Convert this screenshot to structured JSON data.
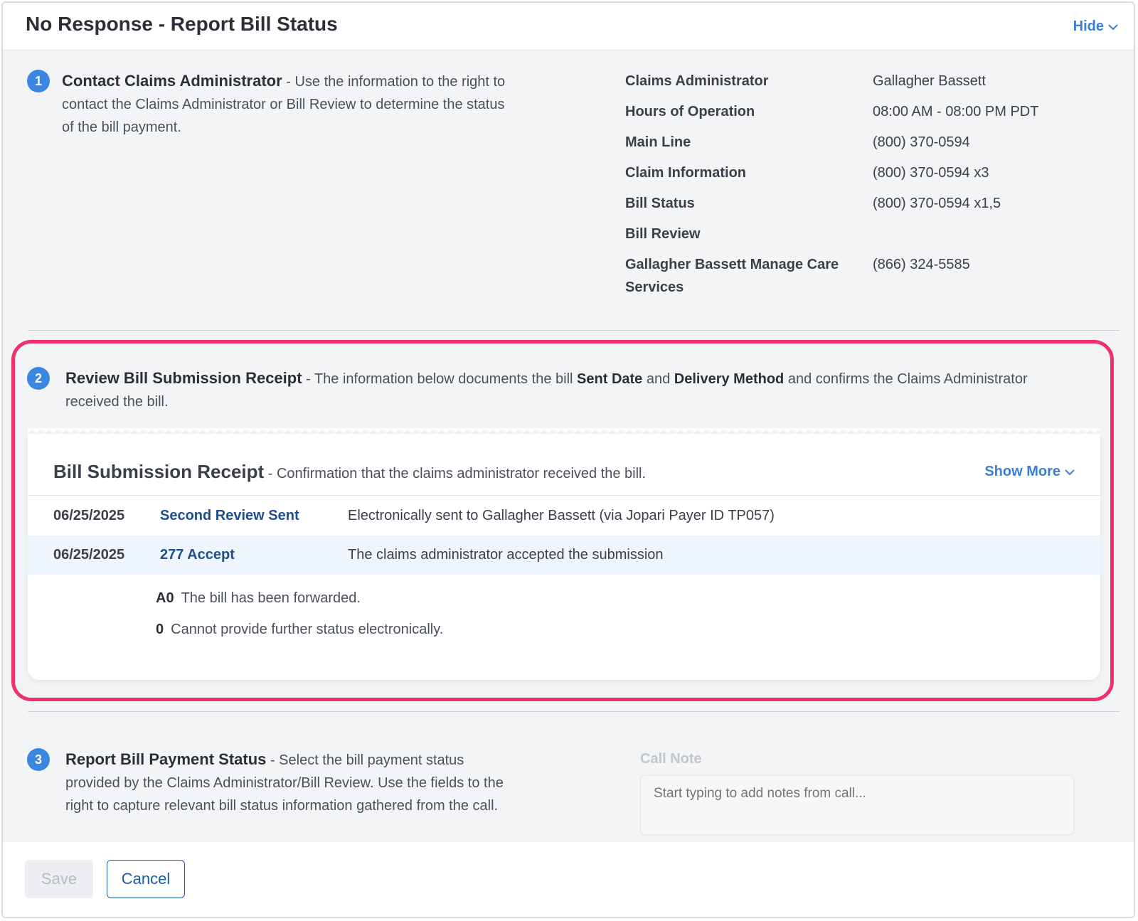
{
  "header": {
    "title": "No Response - Report Bill Status",
    "hide_label": "Hide"
  },
  "step1": {
    "number": "1",
    "heading": "Contact Claims Administrator",
    "text": " - Use the information to the right to contact the Claims Administrator or Bill Review to determine the status of the bill payment."
  },
  "contact_info": [
    {
      "label": "Claims Administrator",
      "value": "Gallagher Bassett"
    },
    {
      "label": "Hours of Operation",
      "value": "08:00 AM - 08:00 PM PDT"
    },
    {
      "label": "Main Line",
      "value": "(800) 370-0594"
    },
    {
      "label": "Claim Information",
      "value": "(800) 370-0594 x3"
    },
    {
      "label": "Bill Status",
      "value": "(800) 370-0594 x1,5"
    },
    {
      "label": "Bill Review",
      "value": ""
    },
    {
      "label": "Gallagher Bassett Manage Care Services",
      "value": "(866) 324-5585"
    }
  ],
  "step2": {
    "number": "2",
    "heading": "Review Bill Submission Receipt",
    "text_a": " - The information below documents the bill ",
    "bold_a": "Sent Date",
    "text_b": " and ",
    "bold_b": "Delivery Method",
    "text_c": " and confirms the Claims Administrator received the bill."
  },
  "receipt": {
    "title": "Bill Submission Receipt",
    "subtitle": " - Confirmation that the claims administrator received the bill.",
    "show_more_label": "Show More",
    "rows": [
      {
        "date": "06/25/2025",
        "event": "Second Review Sent",
        "description": "Electronically sent to Gallagher Bassett (via Jopari Payer ID TP057)"
      },
      {
        "date": "06/25/2025",
        "event": "277 Accept",
        "description": "The claims administrator accepted the submission"
      }
    ],
    "codes": [
      {
        "code": "A0",
        "text": "The bill has been forwarded."
      },
      {
        "code": "0",
        "text": "Cannot provide further status electronically."
      }
    ]
  },
  "step3": {
    "number": "3",
    "heading": "Report Bill Payment Status",
    "text": " - Select the bill payment status provided by the Claims Administrator/Bill Review. Use the fields to the right to capture relevant bill status information gathered from the call."
  },
  "call_note": {
    "label": "Call Note",
    "placeholder": "Start typing to add notes from call..."
  },
  "footer": {
    "save_label": "Save",
    "cancel_label": "Cancel"
  },
  "colors": {
    "accent": "#3b86e0",
    "highlight": "#f0306a",
    "link": "#1f4e8c"
  },
  "icons": {
    "hide": "chevron-down-icon",
    "show_more": "chevron-down-icon"
  }
}
